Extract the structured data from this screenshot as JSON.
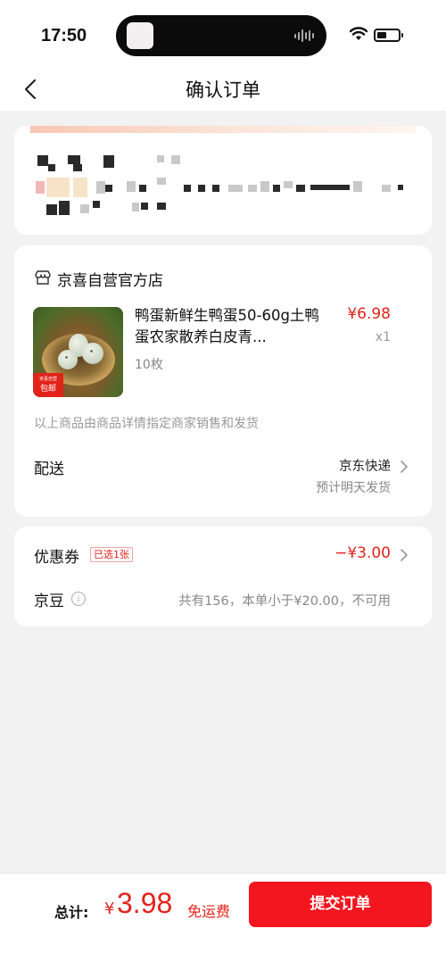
{
  "status_bar": {
    "time": "17:50"
  },
  "nav": {
    "title": "确认订单"
  },
  "shop": {
    "name": "京喜自营官方店",
    "product": {
      "title": "鸭蛋新鲜生鸭蛋50-60g土鸭蛋农家散养白皮青...",
      "spec": "10枚",
      "price": "¥6.98",
      "quantity": "x1",
      "badge_top": "京喜自营",
      "badge_bottom": "包邮"
    },
    "seller_note": "以上商品由商品详情指定商家销售和发货",
    "delivery": {
      "label": "配送",
      "method": "京东快递",
      "eta": "预计明天发货"
    }
  },
  "discounts": {
    "coupon_label": "优惠券",
    "coupon_tag": "已选1张",
    "coupon_amount": "−¥3.00",
    "beans_label": "京豆",
    "beans_text": "共有156，本单小于¥20.00，不可用"
  },
  "footer": {
    "total_label": "总计:",
    "currency": "¥",
    "total_value": "3.98",
    "free_shipping": "免运费",
    "submit_label": "提交订单"
  },
  "colors": {
    "accent": "#e2231a",
    "button": "#f4161f",
    "background": "#f2f2f2"
  }
}
